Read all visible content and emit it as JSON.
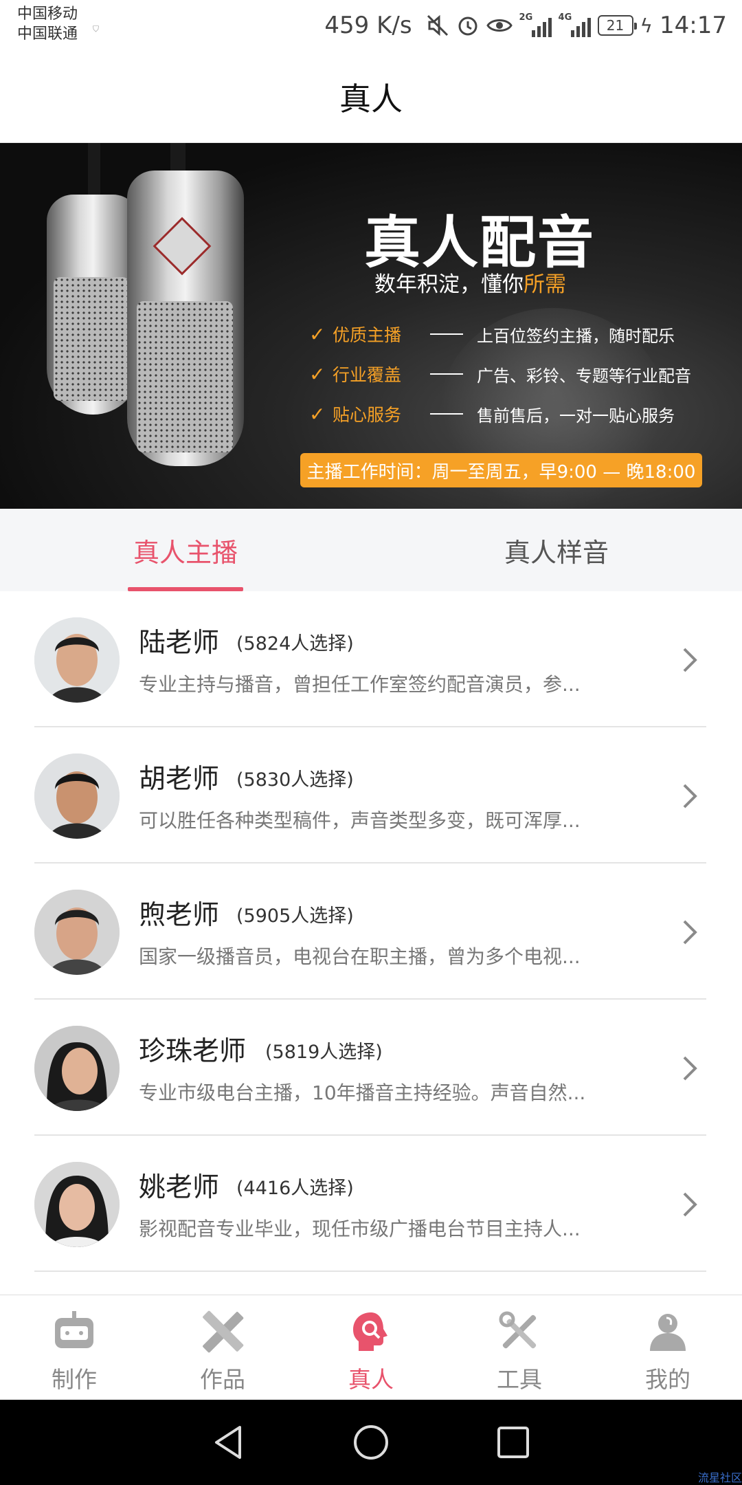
{
  "status_bar": {
    "carrier_1": "中国移动",
    "carrier_2": "中国联通",
    "speed": "459 K/s",
    "sig1_label": "2G",
    "sig2_label": "4G",
    "battery": "21",
    "time": "14:17"
  },
  "header": {
    "title": "真人"
  },
  "banner": {
    "title": "真人配音",
    "subtitle_prefix": "数年积淀，懂你",
    "subtitle_highlight": "所需",
    "features": [
      {
        "key": "优质主播",
        "value": "上百位签约主播，随时配乐"
      },
      {
        "key": "行业覆盖",
        "value": "广告、彩铃、专题等行业配音"
      },
      {
        "key": "贴心服务",
        "value": "售前售后，一对一贴心服务"
      }
    ],
    "hours": "主播工作时间：周一至周五，早9:00 — 晚18:00"
  },
  "tabs": [
    {
      "label": "真人主播",
      "active": true
    },
    {
      "label": "真人样音",
      "active": false
    }
  ],
  "anchors": [
    {
      "name": "陆老师",
      "count": "(5824人选择)",
      "desc": "专业主持与播音，曾担任工作室签约配音演员，参..."
    },
    {
      "name": "胡老师",
      "count": "(5830人选择)",
      "desc": "可以胜任各种类型稿件，声音类型多变，既可浑厚..."
    },
    {
      "name": "煦老师",
      "count": "(5905人选择)",
      "desc": "国家一级播音员，电视台在职主播，曾为多个电视..."
    },
    {
      "name": "珍珠老师",
      "count": "(5819人选择)",
      "desc": "专业市级电台主播，10年播音主持经验。声音自然..."
    },
    {
      "name": "姚老师",
      "count": "(4416人选择)",
      "desc": "影视配音专业毕业，现任市级广播电台节目主持人..."
    }
  ],
  "bottom_nav": [
    {
      "label": "制作",
      "icon": "robot-icon",
      "active": false
    },
    {
      "label": "作品",
      "icon": "pen-ruler-icon",
      "active": false
    },
    {
      "label": "真人",
      "icon": "voice-head-icon",
      "active": true
    },
    {
      "label": "工具",
      "icon": "tools-icon",
      "active": false
    },
    {
      "label": "我的",
      "icon": "user-icon",
      "active": false
    }
  ],
  "watermark": "流星社区",
  "colors": {
    "accent": "#e8536c",
    "banner_orange": "#f6a126",
    "inactive": "#888888"
  }
}
